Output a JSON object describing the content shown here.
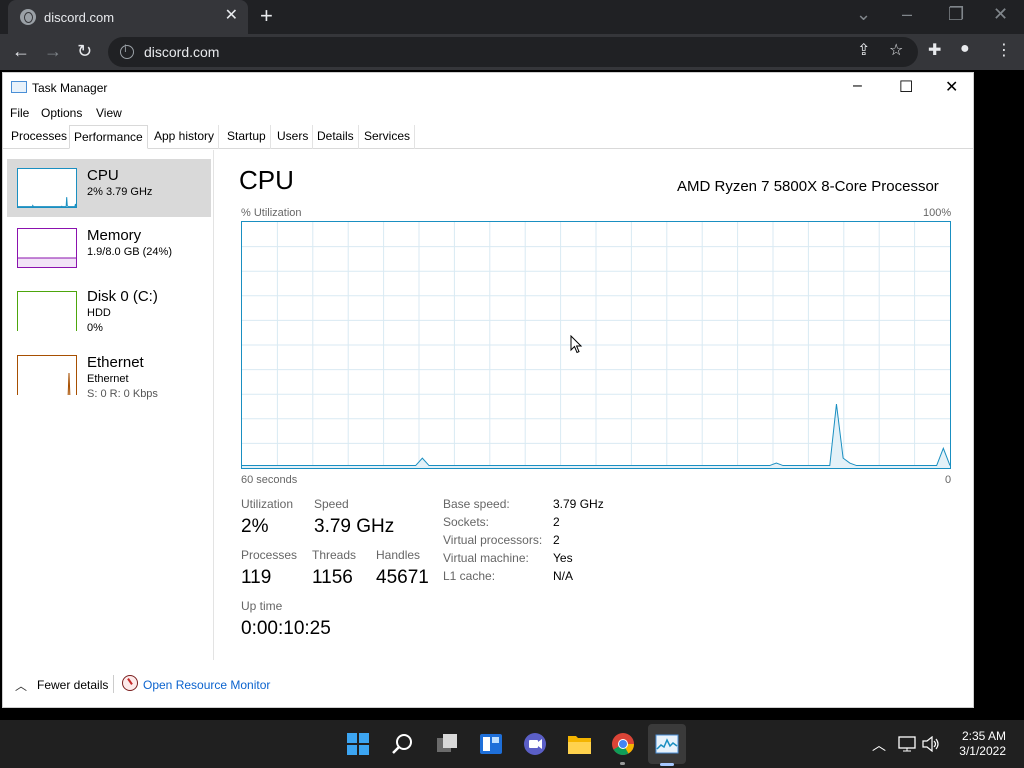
{
  "browser": {
    "tab_title": "discord.com",
    "address": "discord.com"
  },
  "window": {
    "title": "Task Manager",
    "menu": [
      "File",
      "Options",
      "View"
    ],
    "tabs": [
      "Processes",
      "Performance",
      "App history",
      "Startup",
      "Users",
      "Details",
      "Services"
    ],
    "active_tab": "Performance"
  },
  "sidebar": {
    "items": [
      {
        "title": "CPU",
        "line1": "2% 3.79 GHz",
        "line2": "",
        "line3": "",
        "color": "#1a8fc1"
      },
      {
        "title": "Memory",
        "line1": "1.9/8.0 GB (24%)",
        "line2": "",
        "line3": "",
        "color": "#8b12ae"
      },
      {
        "title": "Disk 0 (C:)",
        "line1": "HDD",
        "line2": "0%",
        "line3": "",
        "color": "#4da60c"
      },
      {
        "title": "Ethernet",
        "line1": "Ethernet",
        "line2": "S: 0 R: 0 Kbps",
        "line3": "",
        "color": "#a74f01"
      }
    ]
  },
  "main": {
    "title": "CPU",
    "processor": "AMD Ryzen 7 5800X 8-Core Processor",
    "graph_top_left": "% Utilization",
    "graph_top_right": "100%",
    "graph_bottom_left": "60 seconds",
    "graph_bottom_right": "0",
    "stats": {
      "utilization_label": "Utilization",
      "utilization": "2%",
      "speed_label": "Speed",
      "speed": "3.79 GHz",
      "processes_label": "Processes",
      "processes": "119",
      "threads_label": "Threads",
      "threads": "1156",
      "handles_label": "Handles",
      "handles": "45671",
      "uptime_label": "Up time",
      "uptime": "0:00:10:25"
    },
    "details": [
      {
        "label": "Base speed:",
        "value": "3.79 GHz"
      },
      {
        "label": "Sockets:",
        "value": "2"
      },
      {
        "label": "Virtual processors:",
        "value": "2"
      },
      {
        "label": "Virtual machine:",
        "value": "Yes"
      },
      {
        "label": "L1 cache:",
        "value": "N/A"
      }
    ]
  },
  "cpu_history_percent": [
    1,
    1,
    1,
    1,
    1,
    1,
    1,
    1,
    1,
    1,
    1,
    1,
    1,
    1,
    1,
    1,
    1,
    1,
    1,
    1,
    1,
    1,
    1,
    1,
    1,
    1,
    1,
    4,
    1,
    1,
    1,
    1,
    1,
    1,
    1,
    1,
    1,
    1,
    1,
    1,
    1,
    1,
    1,
    1,
    1,
    1,
    1,
    1,
    1,
    1,
    1,
    1,
    1,
    1,
    1,
    1,
    1,
    1,
    1,
    1,
    1,
    1,
    1,
    1,
    1,
    1,
    1,
    1,
    1,
    1,
    1,
    1,
    1,
    1,
    1,
    1,
    1,
    1,
    1,
    1,
    2,
    1,
    1,
    1,
    1,
    1,
    1,
    1,
    1,
    26,
    4,
    2,
    1,
    1,
    1,
    1,
    1,
    1,
    1,
    1,
    1,
    1,
    1,
    1,
    1,
    8,
    1
  ],
  "footer": {
    "fewer_details": "Fewer details",
    "resource_monitor": "Open Resource Monitor"
  },
  "taskbar": {
    "time": "2:35 AM",
    "date": "3/1/2022",
    "icons": [
      "windows-start-icon",
      "search-icon",
      "task-view-icon",
      "widgets-icon",
      "chat-icon",
      "file-explorer-icon",
      "chrome-icon",
      "task-manager-icon"
    ]
  }
}
